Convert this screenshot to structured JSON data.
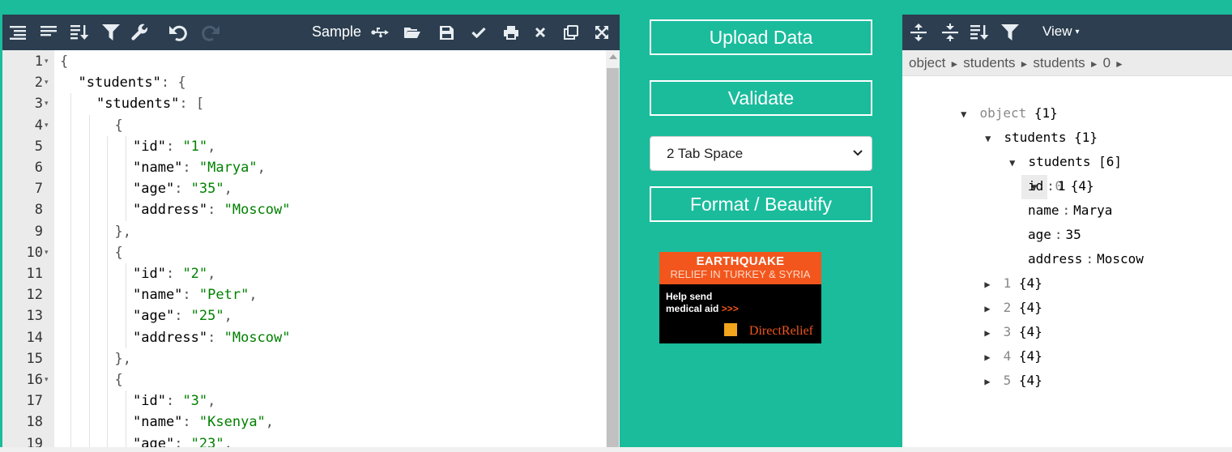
{
  "editor": {
    "toolbar": {
      "sample_label": "Sample"
    },
    "lines": [
      {
        "n": "1",
        "fold": true,
        "indent": 0,
        "parts": [
          [
            "pun",
            "{"
          ]
        ]
      },
      {
        "n": "2",
        "fold": true,
        "indent": 1,
        "parts": [
          [
            "key",
            "\"students\""
          ],
          [
            "pun",
            ": {"
          ]
        ]
      },
      {
        "n": "3",
        "fold": true,
        "indent": 2,
        "parts": [
          [
            "key",
            "\"students\""
          ],
          [
            "pun",
            ": ["
          ]
        ]
      },
      {
        "n": "4",
        "fold": true,
        "indent": 3,
        "parts": [
          [
            "pun",
            "{"
          ]
        ]
      },
      {
        "n": "5",
        "fold": false,
        "indent": 4,
        "parts": [
          [
            "key",
            "\"id\""
          ],
          [
            "pun",
            ": "
          ],
          [
            "str",
            "\"1\""
          ],
          [
            "pun",
            ","
          ]
        ]
      },
      {
        "n": "6",
        "fold": false,
        "indent": 4,
        "parts": [
          [
            "key",
            "\"name\""
          ],
          [
            "pun",
            ": "
          ],
          [
            "str",
            "\"Marya\""
          ],
          [
            "pun",
            ","
          ]
        ]
      },
      {
        "n": "7",
        "fold": false,
        "indent": 4,
        "parts": [
          [
            "key",
            "\"age\""
          ],
          [
            "pun",
            ": "
          ],
          [
            "str",
            "\"35\""
          ],
          [
            "pun",
            ","
          ]
        ]
      },
      {
        "n": "8",
        "fold": false,
        "indent": 4,
        "parts": [
          [
            "key",
            "\"address\""
          ],
          [
            "pun",
            ": "
          ],
          [
            "str",
            "\"Moscow\""
          ]
        ]
      },
      {
        "n": "9",
        "fold": false,
        "indent": 3,
        "parts": [
          [
            "pun",
            "},"
          ]
        ]
      },
      {
        "n": "10",
        "fold": true,
        "indent": 3,
        "parts": [
          [
            "pun",
            "{"
          ]
        ]
      },
      {
        "n": "11",
        "fold": false,
        "indent": 4,
        "parts": [
          [
            "key",
            "\"id\""
          ],
          [
            "pun",
            ": "
          ],
          [
            "str",
            "\"2\""
          ],
          [
            "pun",
            ","
          ]
        ]
      },
      {
        "n": "12",
        "fold": false,
        "indent": 4,
        "parts": [
          [
            "key",
            "\"name\""
          ],
          [
            "pun",
            ": "
          ],
          [
            "str",
            "\"Petr\""
          ],
          [
            "pun",
            ","
          ]
        ]
      },
      {
        "n": "13",
        "fold": false,
        "indent": 4,
        "parts": [
          [
            "key",
            "\"age\""
          ],
          [
            "pun",
            ": "
          ],
          [
            "str",
            "\"25\""
          ],
          [
            "pun",
            ","
          ]
        ]
      },
      {
        "n": "14",
        "fold": false,
        "indent": 4,
        "parts": [
          [
            "key",
            "\"address\""
          ],
          [
            "pun",
            ": "
          ],
          [
            "str",
            "\"Moscow\""
          ]
        ]
      },
      {
        "n": "15",
        "fold": false,
        "indent": 3,
        "parts": [
          [
            "pun",
            "},"
          ]
        ]
      },
      {
        "n": "16",
        "fold": true,
        "indent": 3,
        "parts": [
          [
            "pun",
            "{"
          ]
        ]
      },
      {
        "n": "17",
        "fold": false,
        "indent": 4,
        "parts": [
          [
            "key",
            "\"id\""
          ],
          [
            "pun",
            ": "
          ],
          [
            "str",
            "\"3\""
          ],
          [
            "pun",
            ","
          ]
        ]
      },
      {
        "n": "18",
        "fold": false,
        "indent": 4,
        "parts": [
          [
            "key",
            "\"name\""
          ],
          [
            "pun",
            ": "
          ],
          [
            "str",
            "\"Ksenya\""
          ],
          [
            "pun",
            ","
          ]
        ]
      },
      {
        "n": "19",
        "fold": false,
        "indent": 4,
        "parts": [
          [
            "key",
            "\"age\""
          ],
          [
            "pun",
            ": "
          ],
          [
            "str",
            "\"23\""
          ],
          [
            "pun",
            ","
          ]
        ]
      }
    ]
  },
  "middle": {
    "upload_label": "Upload Data",
    "validate_label": "Validate",
    "tab_select_value": "2 Tab Space",
    "format_label": "Format / Beautify",
    "ad": {
      "title": "EARTHQUAKE",
      "subtitle": "RELIEF IN TURKEY & SYRIA",
      "cta_line1": "Help send",
      "cta_line2": "medical aid",
      "cta_arrows": ">>>",
      "brand": "DirectRelief",
      "accent": "#f2561d"
    }
  },
  "tree_view": {
    "toolbar": {
      "view_label": "View",
      "view_caret": "▾"
    },
    "breadcrumb": [
      "object",
      "students",
      "students",
      "0"
    ],
    "breadcrumb_sep": "►",
    "nodes": {
      "root": {
        "key": "object",
        "count": "{1}"
      },
      "students1": {
        "key": "students",
        "count": "{1}"
      },
      "students2": {
        "key": "students",
        "count": "[6]"
      },
      "item0": {
        "key": "0",
        "count": "{4}"
      },
      "fields": [
        {
          "key": "id",
          "value": "1"
        },
        {
          "key": "name",
          "value": "Marya"
        },
        {
          "key": "age",
          "value": "35"
        },
        {
          "key": "address",
          "value": "Moscow"
        }
      ],
      "collapsed": [
        {
          "key": "1",
          "count": "{4}"
        },
        {
          "key": "2",
          "count": "{4}"
        },
        {
          "key": "3",
          "count": "{4}"
        },
        {
          "key": "4",
          "count": "{4}"
        },
        {
          "key": "5",
          "count": "{4}"
        }
      ]
    }
  },
  "colors": {
    "background": "#1abc9c",
    "toolbar": "#2c3e50",
    "string": "#008000"
  }
}
